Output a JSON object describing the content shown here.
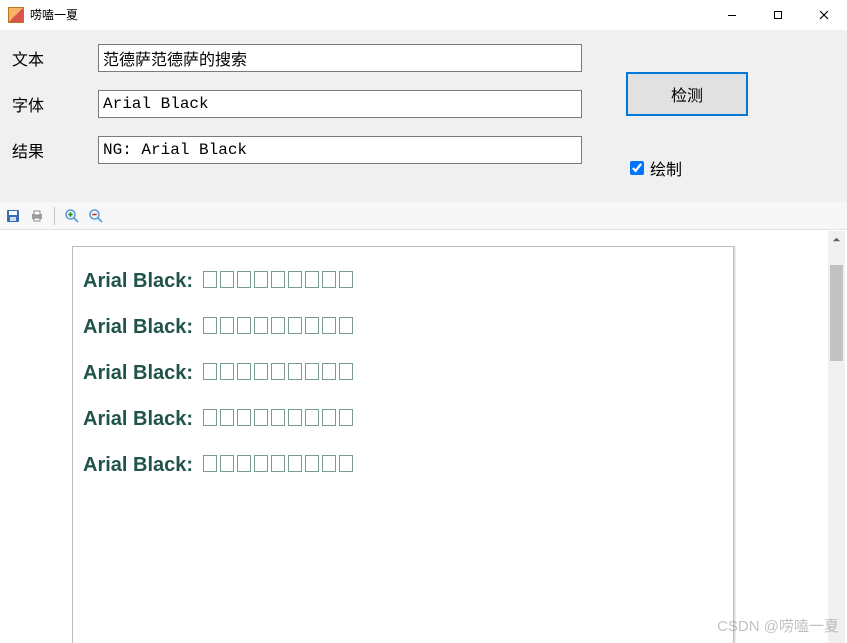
{
  "window": {
    "title": "唠嗑一夏"
  },
  "form": {
    "text_label": "文本",
    "text_value": "范德萨范德萨的搜索",
    "font_label": "字体",
    "font_value": "Arial Black",
    "result_label": "结果",
    "result_value": "NG: Arial Black"
  },
  "actions": {
    "detect_label": "检测",
    "draw_label": "绘制",
    "draw_checked": true
  },
  "toolbar": {
    "icons": [
      "save-icon",
      "print-icon",
      "zoom-in-icon",
      "zoom-out-icon"
    ]
  },
  "preview": {
    "sample_font_label": "Arial Black:",
    "sample_char_count": 9,
    "line_count": 5
  },
  "watermark": "CSDN @唠嗑一夏"
}
